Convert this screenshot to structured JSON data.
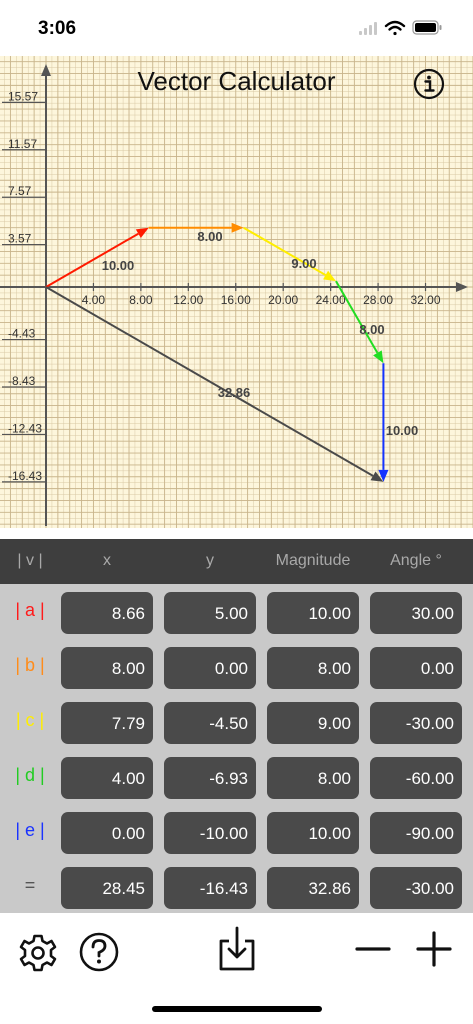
{
  "status_bar": {
    "time": "3:06"
  },
  "app": {
    "title": "Vector Calculator"
  },
  "graph": {
    "y_ticks": [
      "15.57",
      "11.57",
      "7.57",
      "3.57",
      "-4.43",
      "-8.43",
      "-12.43",
      "-16.43"
    ],
    "x_ticks": [
      "4.00",
      "8.00",
      "12.00",
      "16.00",
      "20.00",
      "24.00",
      "28.00",
      "32.00"
    ],
    "vector_labels": [
      "10.00",
      "8.00",
      "9.00",
      "8.00",
      "10.00",
      "32.86"
    ],
    "colors": {
      "a": "#ff1a00",
      "b": "#ff8c00",
      "c": "#ffee00",
      "d": "#22dd22",
      "e": "#1433ff",
      "resultant": "#4a4a4a"
    }
  },
  "table": {
    "headers": [
      "| v |",
      "x",
      "y",
      "Magnitude",
      "Angle °"
    ],
    "rows": [
      {
        "label": "| a |",
        "color": "#ff1a1a",
        "x": "8.66",
        "y": "5.00",
        "magnitude": "10.00",
        "angle": "30.00"
      },
      {
        "label": "| b |",
        "color": "#ff8c1a",
        "x": "8.00",
        "y": "0.00",
        "magnitude": "8.00",
        "angle": "0.00"
      },
      {
        "label": "| c |",
        "color": "#ffee00",
        "x": "7.79",
        "y": "-4.50",
        "magnitude": "9.00",
        "angle": "-30.00"
      },
      {
        "label": "| d |",
        "color": "#22cc22",
        "x": "4.00",
        "y": "-6.93",
        "magnitude": "8.00",
        "angle": "-60.00"
      },
      {
        "label": "| e |",
        "color": "#1a33ff",
        "x": "0.00",
        "y": "-10.00",
        "magnitude": "10.00",
        "angle": "-90.00"
      },
      {
        "label": "=",
        "color": "#555555",
        "x": "28.45",
        "y": "-16.43",
        "magnitude": "32.86",
        "angle": "-30.00"
      }
    ]
  },
  "toolbar": {
    "icons": [
      "gear-icon",
      "help-icon",
      "download-icon",
      "minus-icon",
      "plus-icon"
    ]
  }
}
